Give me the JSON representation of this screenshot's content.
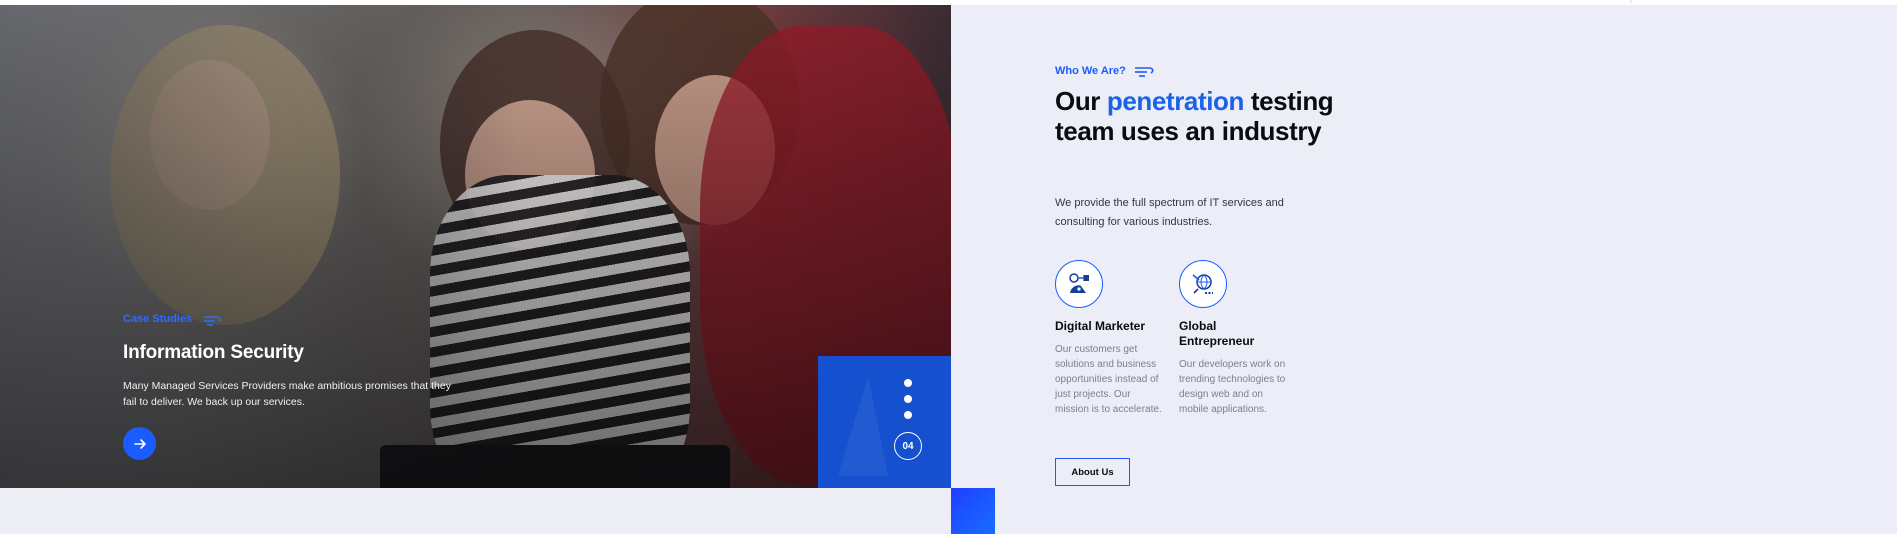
{
  "hero": {
    "tag": "Case Studies",
    "title": "Information Security",
    "description": "Many Managed Services Providers make ambitious promises that they fail to deliver. We back up our services.",
    "arrow_icon": "arrow-right-icon"
  },
  "slider": {
    "dots": 3,
    "counter": "04"
  },
  "about": {
    "tag": "Who We Are?",
    "headline_prefix": "Our ",
    "headline_accent": "penetration",
    "headline_suffix": " testing team uses an industry",
    "intro": "We provide the full spectrum of IT services and consulting for various industries.",
    "features": [
      {
        "icon": "marketer-icon",
        "title": "Digital Marketer",
        "description": "Our customers get solutions and business opportunities instead of just projects. Our mission is to accelerate."
      },
      {
        "icon": "globe-icon",
        "title": "Global Entrepreneur",
        "description": "Our developers work on trending technologies to design web and on mobile applications."
      }
    ],
    "button_label": "About Us"
  },
  "colors": {
    "accent": "#1a5cff",
    "accent_text": "#1a63e8",
    "panel_bg": "#ecedf6",
    "slider_bg": "#1550cf",
    "heading": "#0b0b14"
  }
}
